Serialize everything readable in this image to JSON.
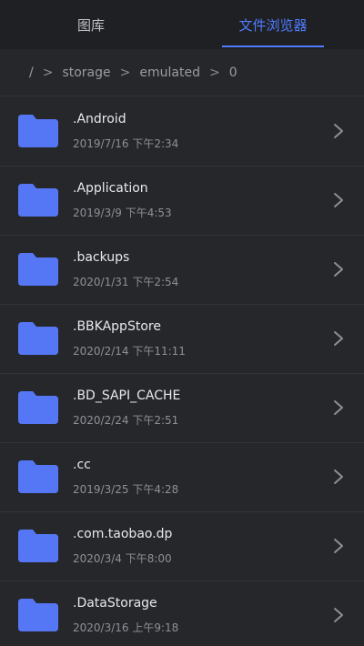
{
  "tabs": [
    {
      "label": "图库",
      "active": false
    },
    {
      "label": "文件浏览器",
      "active": true
    }
  ],
  "breadcrumb": [
    "/",
    "storage",
    "emulated",
    "0"
  ],
  "breadcrumb_separator": ">",
  "colors": {
    "accent": "#4e7dff",
    "folder": "#5577f5",
    "background": "#26272b"
  },
  "files": [
    {
      "name": ".Android",
      "date": "2019/7/16 下午2:34"
    },
    {
      "name": ".Application",
      "date": "2019/3/9 下午4:53"
    },
    {
      "name": ".backups",
      "date": "2020/1/31 下午2:54"
    },
    {
      "name": ".BBKAppStore",
      "date": "2020/2/14 下午11:11"
    },
    {
      "name": ".BD_SAPI_CACHE",
      "date": "2020/2/24 下午2:51"
    },
    {
      "name": ".cc",
      "date": "2019/3/25 下午4:28"
    },
    {
      "name": ".com.taobao.dp",
      "date": "2020/3/4 下午8:00"
    },
    {
      "name": ".DataStorage",
      "date": "2020/3/16 上午9:18"
    }
  ]
}
